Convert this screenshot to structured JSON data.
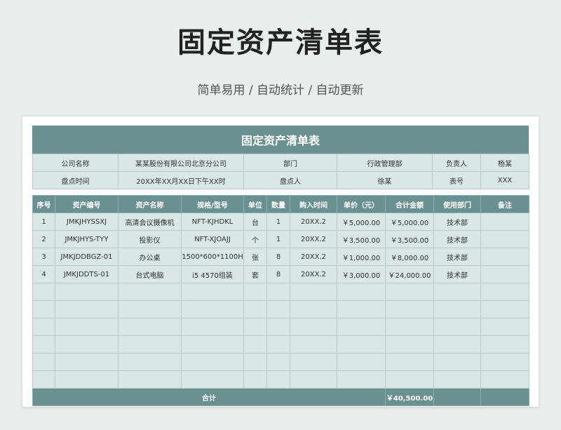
{
  "header": {
    "title": "固定资产清单表",
    "subtitle": "简单易用  /  自动统计  /  自动更新"
  },
  "sheet": {
    "banner": "固定资产清单表",
    "info": {
      "company_label": "公司名称",
      "company_value": "某某股份有限公司北京分公司",
      "dept_label": "部门",
      "dept_value": "行政管理部",
      "owner_label": "负责人",
      "owner_value": "杨某",
      "time_label": "盘点时间",
      "time_value": "20XX年XX月XX日下午XX时",
      "counter_label": "盘点人",
      "counter_value": "徐某",
      "form_label": "表号",
      "form_value": "XXX"
    },
    "columns": [
      "序号",
      "资产编号",
      "资产名称",
      "规格/型号",
      "单位",
      "数量",
      "购入时间",
      "单价（元）",
      "合计金额",
      "使用部门",
      "备注"
    ],
    "rows": [
      [
        "1",
        "JMKJHYSSXJ",
        "高清会议摄像机",
        "NFT-KJHDKL",
        "台",
        "1",
        "20XX.2",
        "￥5,000.00",
        "￥5,000.00",
        "技术部",
        ""
      ],
      [
        "2",
        "JMKJHYS-TYY",
        "投影仪",
        "NFT-XJOAJJ",
        "个",
        "1",
        "20XX.2",
        "￥3,500.00",
        "￥3,500.00",
        "技术部",
        ""
      ],
      [
        "3",
        "JMKJDDBGZ-01",
        "办公桌",
        "1500*600*1100H",
        "张",
        "8",
        "20XX.2",
        "￥1,000.00",
        "￥8,000.00",
        "技术部",
        ""
      ],
      [
        "4",
        "JMKJDDTS-01",
        "台式电脑",
        "i5 4570组装",
        "套",
        "8",
        "20XX.2",
        "￥3,000.00",
        "￥24,000.00",
        "技术部",
        ""
      ],
      [
        "",
        "",
        "",
        "",
        "",
        "",
        "",
        "",
        "",
        "",
        ""
      ],
      [
        "",
        "",
        "",
        "",
        "",
        "",
        "",
        "",
        "",
        "",
        ""
      ],
      [
        "",
        "",
        "",
        "",
        "",
        "",
        "",
        "",
        "",
        "",
        ""
      ],
      [
        "",
        "",
        "",
        "",
        "",
        "",
        "",
        "",
        "",
        "",
        ""
      ],
      [
        "",
        "",
        "",
        "",
        "",
        "",
        "",
        "",
        "",
        "",
        ""
      ],
      [
        "",
        "",
        "",
        "",
        "",
        "",
        "",
        "",
        "",
        "",
        ""
      ]
    ],
    "total": {
      "label": "合计",
      "amount": "￥40,500.00"
    }
  }
}
